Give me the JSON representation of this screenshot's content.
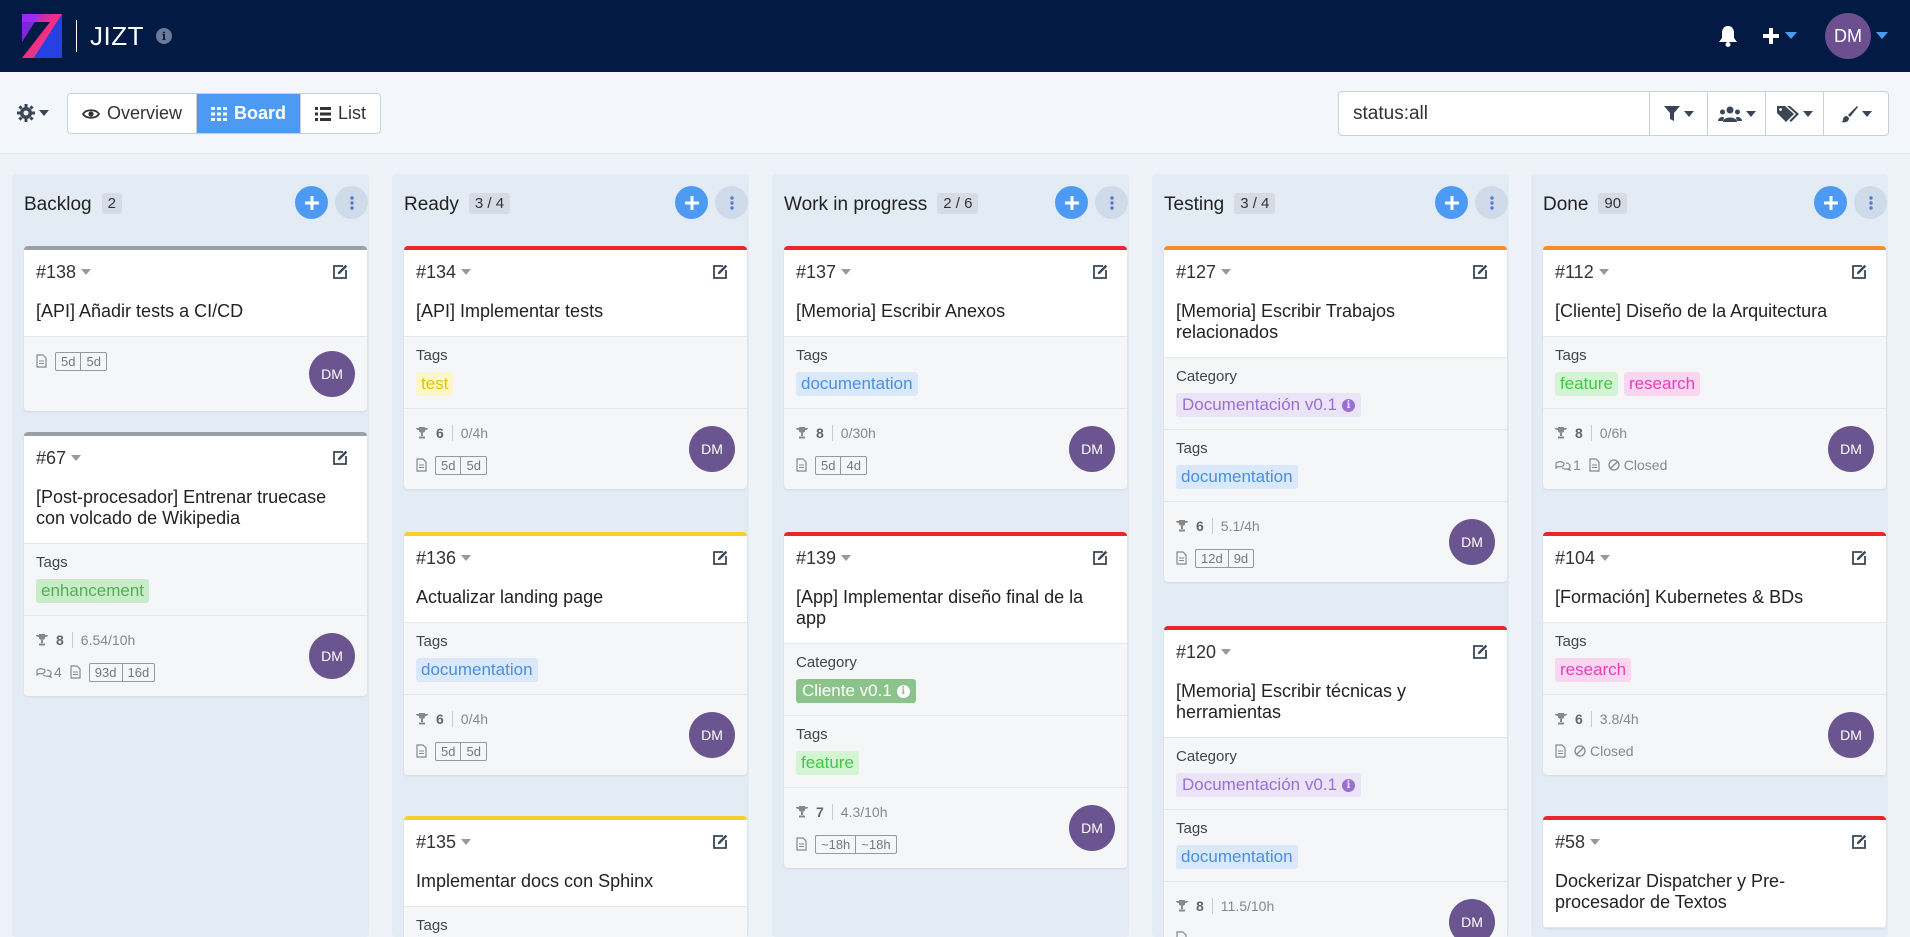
{
  "app": {
    "title": "JIZT"
  },
  "header": {
    "user_initials": "DM"
  },
  "views": [
    {
      "label": "Overview",
      "icon": "eye-icon",
      "active": false
    },
    {
      "label": "Board",
      "icon": "grid-icon",
      "active": true
    },
    {
      "label": "List",
      "icon": "list-icon",
      "active": false
    }
  ],
  "search": {
    "value": "status:all"
  },
  "colors": {
    "accent": "#4d9af5",
    "header_bg": "#031a45",
    "avatar": "#6b5590"
  },
  "columns": [
    {
      "title": "Backlog",
      "count": "2",
      "cards": [
        {
          "id": "#138",
          "title": "[API] Añadir tests a CI/CD",
          "priority_color": "#9aa0a6",
          "dates": [
            "5d",
            "5d"
          ],
          "avatar": "DM"
        },
        {
          "id": "#67",
          "title": "[Post-procesador] Entrenar truecase con volcado de Wikipedia",
          "priority_color": "#9aa0a6",
          "tags_label": "Tags",
          "tags": [
            {
              "label": "enhancement",
              "cls": "tag-enh"
            }
          ],
          "points": "8",
          "hours": "6.54/10h",
          "comments": "4",
          "dates": [
            "93d",
            "16d"
          ],
          "avatar": "DM"
        }
      ]
    },
    {
      "title": "Ready",
      "count": "3 / 4",
      "cards": [
        {
          "id": "#134",
          "title": "[API] Implementar tests",
          "priority_color": "#e8262b",
          "tags_label": "Tags",
          "tags": [
            {
              "label": "test",
              "cls": "tag-test"
            }
          ],
          "points": "6",
          "hours": "0/4h",
          "dates": [
            "5d",
            "5d"
          ],
          "avatar": "DM"
        },
        {
          "id": "#136",
          "title": "Actualizar landing page",
          "priority_color": "#f6cf2a",
          "tags_label": "Tags",
          "tags": [
            {
              "label": "documentation",
              "cls": "tag-doc"
            }
          ],
          "points": "6",
          "hours": "0/4h",
          "dates": [
            "5d",
            "5d"
          ],
          "avatar": "DM"
        },
        {
          "id": "#135",
          "title": "Implementar docs con Sphinx",
          "priority_color": "#f6cf2a",
          "tags_label": "Tags"
        }
      ]
    },
    {
      "title": "Work in progress",
      "count": "2 / 6",
      "cards": [
        {
          "id": "#137",
          "title": "[Memoria] Escribir Anexos",
          "priority_color": "#e8262b",
          "tags_label": "Tags",
          "tags": [
            {
              "label": "documentation",
              "cls": "tag-doc"
            }
          ],
          "points": "8",
          "hours": "0/30h",
          "dates": [
            "5d",
            "4d"
          ],
          "avatar": "DM"
        },
        {
          "id": "#139",
          "title": "[App] Implementar diseño final de la app",
          "priority_color": "#e8262b",
          "category_label": "Category",
          "category": {
            "label": "Cliente v0.1",
            "cls": "cat-cli"
          },
          "tags_label": "Tags",
          "tags": [
            {
              "label": "feature",
              "cls": "tag-feat"
            }
          ],
          "points": "7",
          "hours": "4.3/10h",
          "dates": [
            "~18h",
            "~18h"
          ],
          "avatar": "DM"
        }
      ]
    },
    {
      "title": "Testing",
      "count": "3 / 4",
      "cards": [
        {
          "id": "#127",
          "title": "[Memoria] Escribir Trabajos relacionados",
          "priority_color": "#f78c2a",
          "category_label": "Category",
          "category": {
            "label": "Documentación v0.1",
            "cls": "cat-doc"
          },
          "tags_label": "Tags",
          "tags": [
            {
              "label": "documentation",
              "cls": "tag-doc"
            }
          ],
          "points": "6",
          "hours": "5.1/4h",
          "dates": [
            "12d",
            "9d"
          ],
          "avatar": "DM"
        },
        {
          "id": "#120",
          "title": "[Memoria] Escribir técnicas y herramientas",
          "priority_color": "#e8262b",
          "category_label": "Category",
          "category": {
            "label": "Documentación v0.1",
            "cls": "cat-doc"
          },
          "tags_label": "Tags",
          "tags": [
            {
              "label": "documentation",
              "cls": "tag-doc"
            }
          ],
          "points": "8",
          "hours": "11.5/10h",
          "avatar": "DM"
        }
      ]
    },
    {
      "title": "Done",
      "count": "90",
      "cards": [
        {
          "id": "#112",
          "title": "[Cliente] Diseño de la Arquitectura",
          "priority_color": "#f78c2a",
          "tags_label": "Tags",
          "tags": [
            {
              "label": "feature",
              "cls": "tag-feat"
            },
            {
              "label": "research",
              "cls": "tag-res"
            }
          ],
          "points": "8",
          "hours": "0/6h",
          "comments": "1",
          "closed": "Closed",
          "avatar": "DM"
        },
        {
          "id": "#104",
          "title": "[Formación] Kubernetes & BDs",
          "priority_color": "#e8262b",
          "tags_label": "Tags",
          "tags": [
            {
              "label": "research",
              "cls": "tag-res"
            }
          ],
          "points": "6",
          "hours": "3.8/4h",
          "closed": "Closed",
          "avatar": "DM"
        },
        {
          "id": "#58",
          "title": "Dockerizar Dispatcher y Pre-procesador de Textos",
          "priority_color": "#e8262b"
        }
      ]
    }
  ]
}
